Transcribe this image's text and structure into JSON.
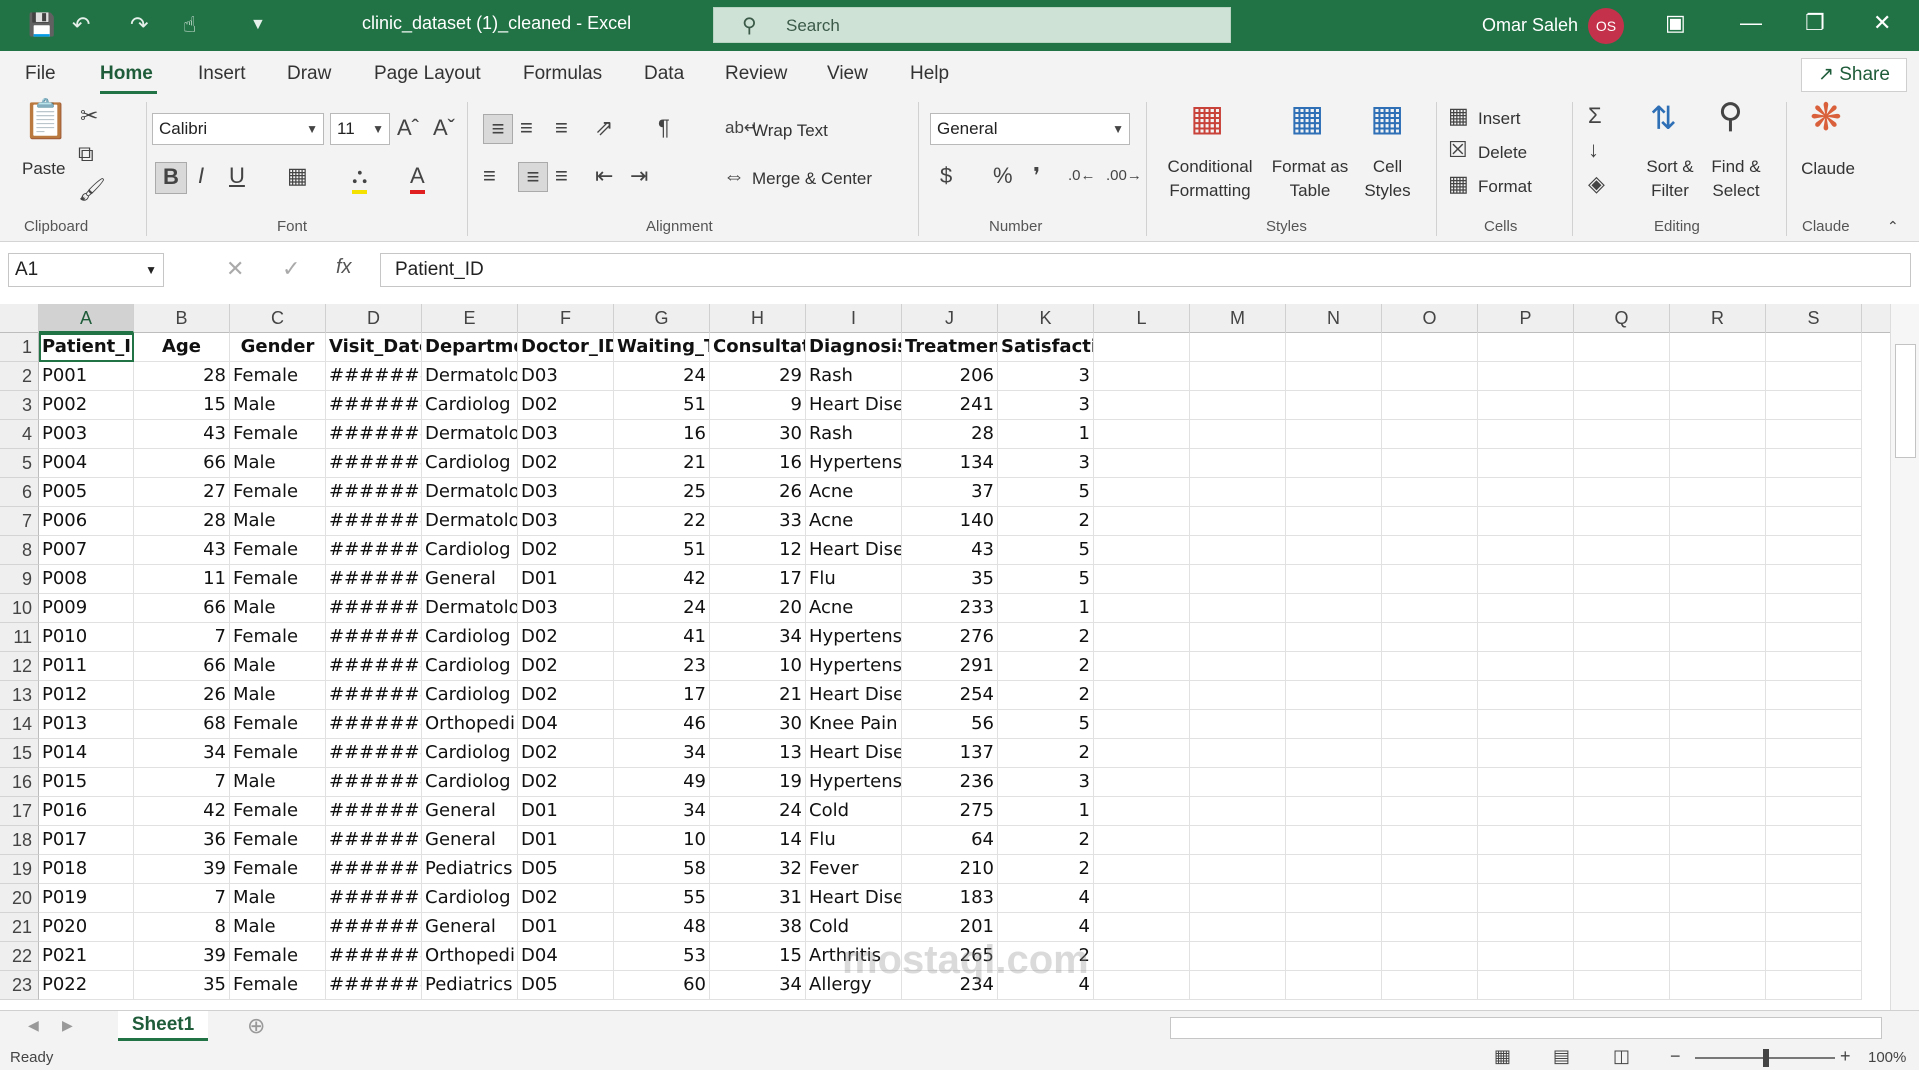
{
  "titlebar": {
    "filename": "clinic_dataset (1)_cleaned  -  Excel",
    "search_placeholder": "Search",
    "user_name": "Omar Saleh",
    "user_initials": "OS"
  },
  "tabs": [
    "File",
    "Home",
    "Insert",
    "Draw",
    "Page Layout",
    "Formulas",
    "Data",
    "Review",
    "View",
    "Help"
  ],
  "share_label": "Share",
  "ribbon": {
    "clipboard": {
      "label": "Clipboard",
      "paste": "Paste"
    },
    "font": {
      "label": "Font",
      "family": "Calibri",
      "size": "11"
    },
    "alignment": {
      "label": "Alignment",
      "wrap": "Wrap Text",
      "merge": "Merge & Center"
    },
    "number": {
      "label": "Number",
      "format": "General"
    },
    "styles": {
      "label": "Styles",
      "conditional": "Conditional",
      "conditional2": "Formatting",
      "format_table": "Format as",
      "format_table2": "Table",
      "cell_styles": "Cell",
      "cell_styles2": "Styles"
    },
    "cells": {
      "label": "Cells",
      "insert": "Insert",
      "delete": "Delete",
      "format": "Format"
    },
    "editing": {
      "label": "Editing",
      "sort": "Sort &",
      "sort2": "Filter",
      "find": "Find &",
      "find2": "Select"
    },
    "claude": {
      "label": "Claude",
      "button": "Claude"
    }
  },
  "formula": {
    "namebox": "A1",
    "fx": "fx",
    "content": "Patient_ID"
  },
  "columns": [
    "A",
    "B",
    "C",
    "D",
    "E",
    "F",
    "G",
    "H",
    "I",
    "J",
    "K",
    "L",
    "M",
    "N",
    "O",
    "P",
    "Q",
    "R",
    "S"
  ],
  "header_row": [
    "Patient_ID",
    "Age",
    "Gender",
    "Visit_Date",
    "Department",
    "Doctor_ID",
    "Waiting_Time",
    "Consultation_T",
    "Diagnosis",
    "Treatment_Cost",
    "Satisfaction"
  ],
  "rows": [
    [
      "P001",
      "28",
      "Female",
      "########",
      "Dermatolo",
      "D03",
      "24",
      "29",
      "Rash",
      "206",
      "3"
    ],
    [
      "P002",
      "15",
      "Male",
      "########",
      "Cardiolog",
      "D02",
      "51",
      "9",
      "Heart Dise",
      "241",
      "3"
    ],
    [
      "P003",
      "43",
      "Female",
      "########",
      "Dermatolo",
      "D03",
      "16",
      "30",
      "Rash",
      "28",
      "1"
    ],
    [
      "P004",
      "66",
      "Male",
      "########",
      "Cardiolog",
      "D02",
      "21",
      "16",
      "Hypertens",
      "134",
      "3"
    ],
    [
      "P005",
      "27",
      "Female",
      "########",
      "Dermatolo",
      "D03",
      "25",
      "26",
      "Acne",
      "37",
      "5"
    ],
    [
      "P006",
      "28",
      "Male",
      "########",
      "Dermatolo",
      "D03",
      "22",
      "33",
      "Acne",
      "140",
      "2"
    ],
    [
      "P007",
      "43",
      "Female",
      "########",
      "Cardiolog",
      "D02",
      "51",
      "12",
      "Heart Dise",
      "43",
      "5"
    ],
    [
      "P008",
      "11",
      "Female",
      "########",
      "General",
      "D01",
      "42",
      "17",
      "Flu",
      "35",
      "5"
    ],
    [
      "P009",
      "66",
      "Male",
      "########",
      "Dermatolo",
      "D03",
      "24",
      "20",
      "Acne",
      "233",
      "1"
    ],
    [
      "P010",
      "7",
      "Female",
      "########",
      "Cardiolog",
      "D02",
      "41",
      "34",
      "Hypertens",
      "276",
      "2"
    ],
    [
      "P011",
      "66",
      "Male",
      "########",
      "Cardiolog",
      "D02",
      "23",
      "10",
      "Hypertens",
      "291",
      "2"
    ],
    [
      "P012",
      "26",
      "Male",
      "########",
      "Cardiolog",
      "D02",
      "17",
      "21",
      "Heart Dise",
      "254",
      "2"
    ],
    [
      "P013",
      "68",
      "Female",
      "########",
      "Orthopedi",
      "D04",
      "46",
      "30",
      "Knee Pain",
      "56",
      "5"
    ],
    [
      "P014",
      "34",
      "Female",
      "########",
      "Cardiolog",
      "D02",
      "34",
      "13",
      "Heart Dise",
      "137",
      "2"
    ],
    [
      "P015",
      "7",
      "Male",
      "########",
      "Cardiolog",
      "D02",
      "49",
      "19",
      "Hypertens",
      "236",
      "3"
    ],
    [
      "P016",
      "42",
      "Female",
      "########",
      "General",
      "D01",
      "34",
      "24",
      "Cold",
      "275",
      "1"
    ],
    [
      "P017",
      "36",
      "Female",
      "########",
      "General",
      "D01",
      "10",
      "14",
      "Flu",
      "64",
      "2"
    ],
    [
      "P018",
      "39",
      "Female",
      "########",
      "Pediatrics",
      "D05",
      "58",
      "32",
      "Fever",
      "210",
      "2"
    ],
    [
      "P019",
      "7",
      "Male",
      "########",
      "Cardiolog",
      "D02",
      "55",
      "31",
      "Heart Dise",
      "183",
      "4"
    ],
    [
      "P020",
      "8",
      "Male",
      "########",
      "General",
      "D01",
      "48",
      "38",
      "Cold",
      "201",
      "4"
    ],
    [
      "P021",
      "39",
      "Female",
      "########",
      "Orthopedi",
      "D04",
      "53",
      "15",
      "Arthritis",
      "265",
      "2"
    ],
    [
      "P022",
      "35",
      "Female",
      "########",
      "Pediatrics",
      "D05",
      "60",
      "34",
      "Allergy",
      "234",
      "4"
    ]
  ],
  "sheet_tab": "Sheet1",
  "status": {
    "ready": "Ready",
    "zoom": "100%"
  },
  "watermark": "mostaql.com"
}
